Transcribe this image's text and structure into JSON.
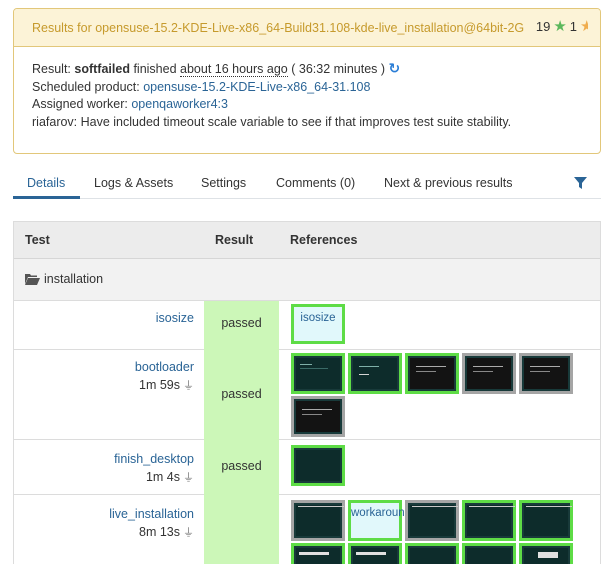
{
  "summary": {
    "title": "Results for opensuse-15.2-KDE-Live-x86_64-Build31.108-kde-live_installation@64bit-2G",
    "rating_count": "19",
    "rating_half": "1",
    "result_label": "Result:",
    "result_value": "softfailed",
    "finished_label": "finished",
    "finished_ago": "about 16 hours ago",
    "duration": "( 36:32 minutes )",
    "product_label": "Scheduled product:",
    "product_value": "opensuse-15.2-KDE-Live-x86_64-31.108",
    "worker_label": "Assigned worker:",
    "worker_value": "openqaworker4:3",
    "comment": "riafarov: Have included timeout scale variable to see if that improves test suite stability."
  },
  "tabs": [
    {
      "label": "Details"
    },
    {
      "label": "Logs & Assets"
    },
    {
      "label": "Settings"
    },
    {
      "label": "Comments (0)"
    },
    {
      "label": "Next & previous results"
    }
  ],
  "table": {
    "headers": {
      "test": "Test",
      "result": "Result",
      "references": "References"
    },
    "category": "installation",
    "rows": [
      {
        "name": "isosize",
        "time": "",
        "result": "passed",
        "thumbs": [
          {
            "text": "isosize"
          }
        ]
      },
      {
        "name": "bootloader",
        "time": "1m 59s",
        "result": "passed"
      },
      {
        "name": "finish_desktop",
        "time": "1m 4s",
        "result": "passed"
      },
      {
        "name": "live_installation",
        "time": "8m 13s",
        "result": "",
        "thumb_text": "workaround"
      }
    ]
  },
  "colors": {
    "warning_border": "#e2c77a",
    "warning_bg": "#fcf3d7",
    "link": "#2a6496",
    "passed_bg": "#ccf7b8",
    "thumb_ok": "#5edc46",
    "thumb_neutral": "#a5a5a5"
  },
  "icons": {
    "reload": "reload-icon",
    "star": "star-icon",
    "filter": "filter-icon",
    "folder": "folder-open-icon",
    "plug": "plug-icon"
  }
}
